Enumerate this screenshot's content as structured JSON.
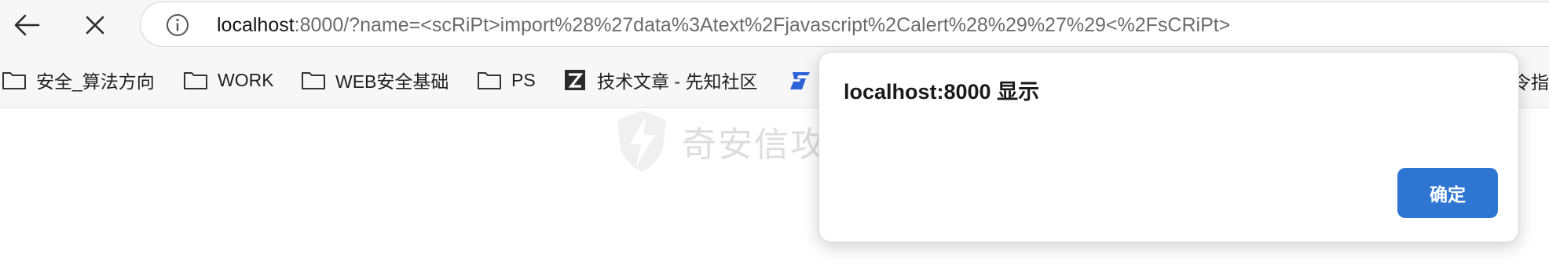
{
  "address_bar": {
    "host": "localhost",
    "rest": ":8000/?name=<scRiPt>import%28%27data%3Atext%2Fjavascript%2Calert%28%29%27%29<%2FsCRiPt>"
  },
  "icons": {
    "back": "arrow-left-icon",
    "stop": "close-icon",
    "info": "info-circle-icon",
    "folder": "folder-icon",
    "xianzhi": "xianzhi-logo-icon",
    "baidu": "baidu-logo-icon"
  },
  "bookmarks": {
    "items": [
      {
        "label": "安全_算法方向"
      },
      {
        "label": "WORK"
      },
      {
        "label": "WEB安全基础"
      },
      {
        "label": "PS"
      },
      {
        "label": "技术文章 - 先知社区"
      }
    ],
    "overflow_partial": "令指"
  },
  "watermark": {
    "text": "奇安信攻防社区"
  },
  "dialog": {
    "title": "localhost:8000 显示",
    "ok_label": "确定"
  },
  "colors": {
    "accent": "#2f76d2",
    "toolbar_bg": "#f7f7f7",
    "baidu_blue": "#2d63d8"
  }
}
